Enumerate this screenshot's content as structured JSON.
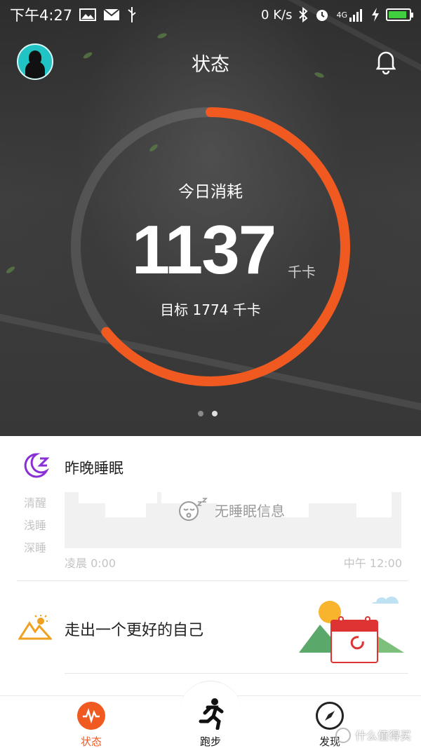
{
  "status_bar": {
    "time": "下午4:27",
    "net_speed": "0 K/s",
    "network": "4G",
    "battery_color": "#3fcf3f",
    "battery_level": 0.9
  },
  "header": {
    "title": "状态"
  },
  "calorie_ring": {
    "label": "今日消耗",
    "value": "1137",
    "unit": "千卡",
    "target_text": "目标 1774 千卡",
    "consumed": 1137,
    "target": 1774,
    "accent": "#f05a21",
    "page_count": 2,
    "active_page": 2
  },
  "sleep": {
    "title": "昨晚睡眠",
    "levels": [
      "清醒",
      "浅睡",
      "深睡"
    ],
    "empty_text": "无睡眠信息",
    "axis_start": "凌晨 0:00",
    "axis_end": "中午 12:00",
    "icon": "moon-z-icon",
    "accent": "#8a2fd6"
  },
  "goal": {
    "title": "走出一个更好的自己",
    "icon": "mountain-sun-icon"
  },
  "nav": {
    "items": [
      {
        "label": "状态",
        "icon": "activity-icon"
      },
      {
        "label": "跑步",
        "icon": "runner-icon"
      },
      {
        "label": "发现",
        "icon": "compass-icon"
      }
    ],
    "active_color": "#f05a21"
  },
  "watermark": {
    "text": "什么值得买"
  }
}
